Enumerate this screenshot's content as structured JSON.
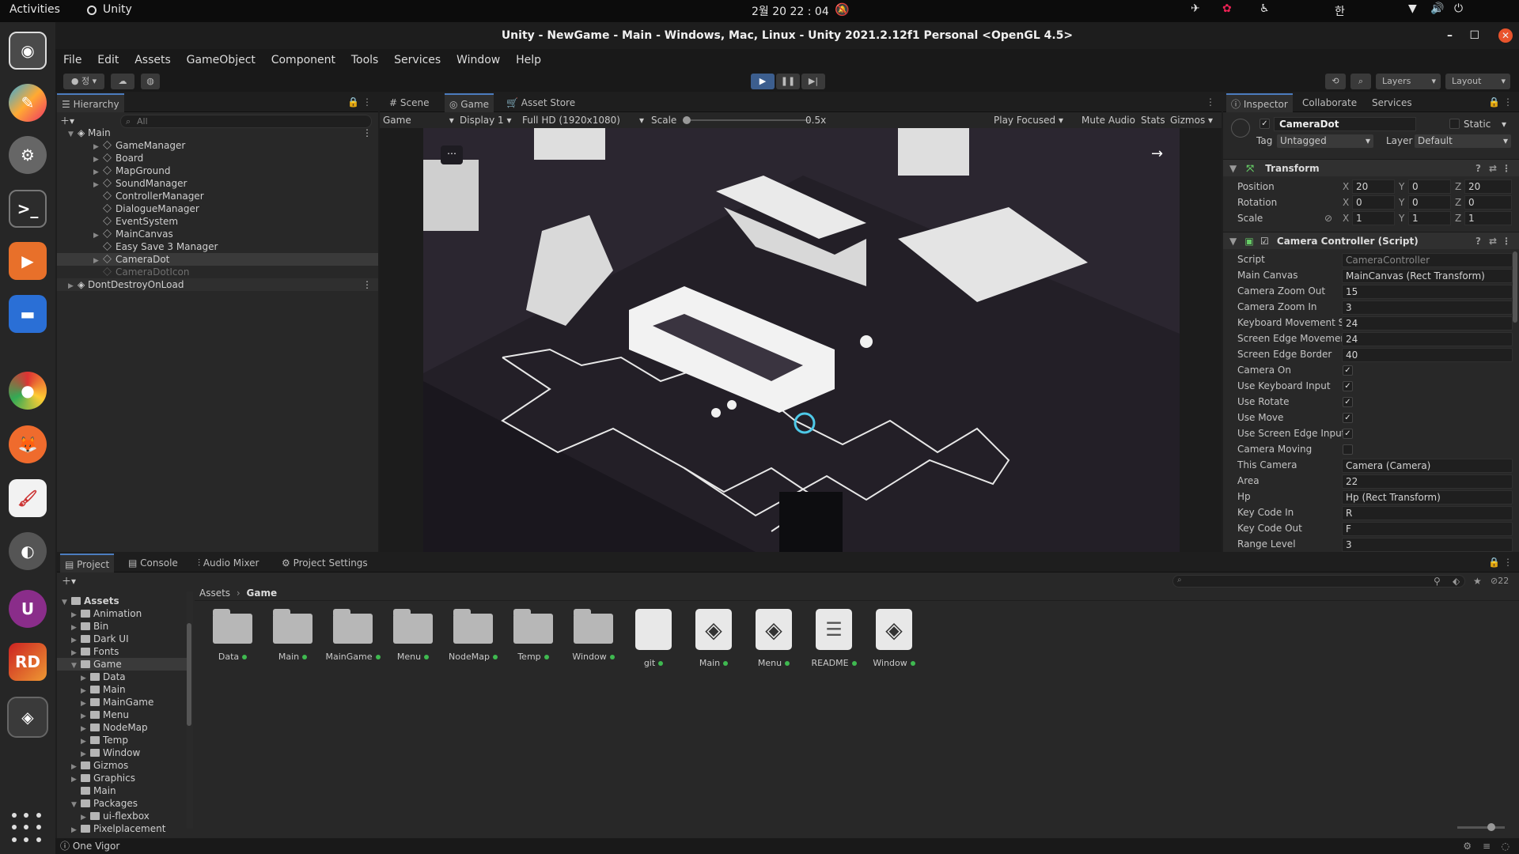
{
  "topbar": {
    "activities": "Activities",
    "app_name": "Unity",
    "clock": "2월 20  22 : 04",
    "ime": "한"
  },
  "window": {
    "title": "Unity - NewGame - Main - Windows, Mac, Linux - Unity 2021.2.12f1 Personal <OpenGL 4.5>"
  },
  "menu": [
    "File",
    "Edit",
    "Assets",
    "GameObject",
    "Component",
    "Tools",
    "Services",
    "Window",
    "Help"
  ],
  "toolbar": {
    "account": "정",
    "layers": "Layers",
    "layout": "Layout"
  },
  "hierarchy": {
    "tab": "Hierarchy",
    "search_placeholder": "All",
    "scene": "Main",
    "items": [
      "GameManager",
      "Board",
      "MapGround",
      "SoundManager",
      "ControllerManager",
      "DialogueManager",
      "EventSystem",
      "MainCanvas",
      "Easy Save 3 Manager",
      "CameraDot",
      "CameraDotIcon"
    ],
    "ddol": "DontDestroyOnLoad"
  },
  "game_view": {
    "tabs": [
      "Scene",
      "Game",
      "Asset Store"
    ],
    "game_dropdown": "Game",
    "display": "Display 1",
    "resolution": "Full HD (1920x1080)",
    "scale_label": "Scale",
    "scale_value": "0.5x",
    "play_focused": "Play Focused",
    "mute_audio": "Mute Audio",
    "stats": "Stats",
    "gizmos": "Gizmos",
    "scale_level": 0.0
  },
  "inspector": {
    "tabs": [
      "Inspector",
      "Collaborate",
      "Services"
    ],
    "object_name": "CameraDot",
    "static_label": "Static",
    "tag_label": "Tag",
    "tag_value": "Untagged",
    "layer_label": "Layer",
    "layer_value": "Default",
    "transform": {
      "title": "Transform",
      "position_label": "Position",
      "position": [
        "20",
        "0",
        "20"
      ],
      "rotation_label": "Rotation",
      "rotation": [
        "0",
        "0",
        "0"
      ],
      "scale_label": "Scale",
      "scale": [
        "1",
        "1",
        "1"
      ]
    },
    "script": {
      "title": "Camera Controller (Script)",
      "fields": [
        {
          "label": "Script",
          "value": "CameraController"
        },
        {
          "label": "Main Canvas",
          "value": "MainCanvas (Rect Transform)"
        },
        {
          "label": "Camera Zoom Out",
          "value": "15"
        },
        {
          "label": "Camera Zoom In",
          "value": "3"
        },
        {
          "label": "Keyboard Movement S",
          "value": "24"
        },
        {
          "label": "Screen Edge Movemer",
          "value": "24"
        },
        {
          "label": "Screen Edge Border",
          "value": "40"
        },
        {
          "label": "Camera On",
          "value": "✓"
        },
        {
          "label": "Use Keyboard Input",
          "value": "✓"
        },
        {
          "label": "Use Rotate",
          "value": "✓"
        },
        {
          "label": "Use Move",
          "value": "✓"
        },
        {
          "label": "Use Screen Edge Input",
          "value": "✓"
        },
        {
          "label": "Camera Moving",
          "value": ""
        },
        {
          "label": "This Camera",
          "value": "Camera (Camera)"
        },
        {
          "label": "Area",
          "value": "22"
        },
        {
          "label": "Hp",
          "value": "Hp (Rect Transform)"
        },
        {
          "label": "Key Code In",
          "value": "R"
        },
        {
          "label": "Key Code Out",
          "value": "F"
        },
        {
          "label": "Range Level",
          "value": "3"
        }
      ]
    }
  },
  "project": {
    "tabs": [
      "Project",
      "Console",
      "Audio Mixer",
      "Project Settings"
    ],
    "hidden_count": "22",
    "breadcrumb": [
      "Assets",
      "Game"
    ],
    "tree": [
      {
        "label": "Assets",
        "depth": 0
      },
      {
        "label": "Animation",
        "depth": 1
      },
      {
        "label": "Bin",
        "depth": 1
      },
      {
        "label": "Dark UI",
        "depth": 1
      },
      {
        "label": "Fonts",
        "depth": 1
      },
      {
        "label": "Game",
        "depth": 1
      },
      {
        "label": "Data",
        "depth": 2
      },
      {
        "label": "Main",
        "depth": 2
      },
      {
        "label": "MainGame",
        "depth": 2
      },
      {
        "label": "Menu",
        "depth": 2
      },
      {
        "label": "NodeMap",
        "depth": 2
      },
      {
        "label": "Temp",
        "depth": 2
      },
      {
        "label": "Window",
        "depth": 2
      },
      {
        "label": "Gizmos",
        "depth": 1
      },
      {
        "label": "Graphics",
        "depth": 1
      },
      {
        "label": "Main",
        "depth": 1
      },
      {
        "label": "Packages",
        "depth": 1
      },
      {
        "label": "ui-flexbox",
        "depth": 2
      },
      {
        "label": "Pixelplacement",
        "depth": 1
      }
    ],
    "assets": [
      {
        "label": "Data",
        "type": "folder"
      },
      {
        "label": "Main",
        "type": "folder"
      },
      {
        "label": "MainGame",
        "type": "folder"
      },
      {
        "label": "Menu",
        "type": "folder"
      },
      {
        "label": "NodeMap",
        "type": "folder"
      },
      {
        "label": "Temp",
        "type": "folder"
      },
      {
        "label": "Window",
        "type": "folder"
      },
      {
        "label": "git",
        "type": "file"
      },
      {
        "label": "Main",
        "type": "unity"
      },
      {
        "label": "Menu",
        "type": "unity"
      },
      {
        "label": "README",
        "type": "text"
      },
      {
        "label": "Window",
        "type": "unity"
      }
    ]
  },
  "statusbar": {
    "text": "One Vigor"
  }
}
